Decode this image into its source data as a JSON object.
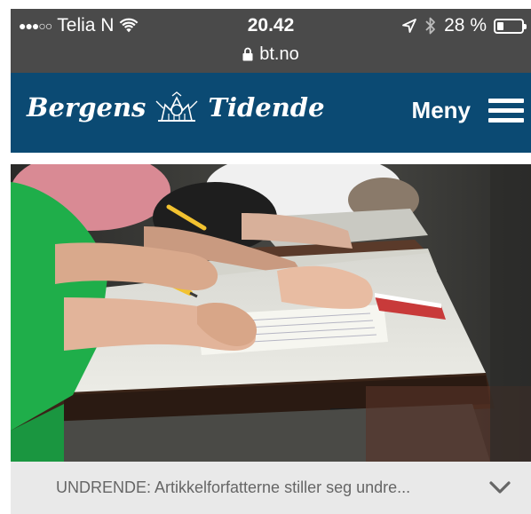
{
  "status_bar": {
    "signal": "●●●○○",
    "carrier": "Telia N",
    "time": "20.42",
    "battery_percent": "28 %",
    "battery_level": 0.28,
    "url": "bt.no",
    "icons": [
      "wifi-icon",
      "location-arrow-icon",
      "bluetooth-icon",
      "battery-icon",
      "lock-icon"
    ]
  },
  "header": {
    "logo_text_left": "Bergens",
    "logo_text_right": "Tidende",
    "menu_label": "Meny",
    "background_color": "#0b4a73"
  },
  "hero": {
    "caption": "UNDRENDE: Artikkelforfatterne stiller seg undre..."
  }
}
